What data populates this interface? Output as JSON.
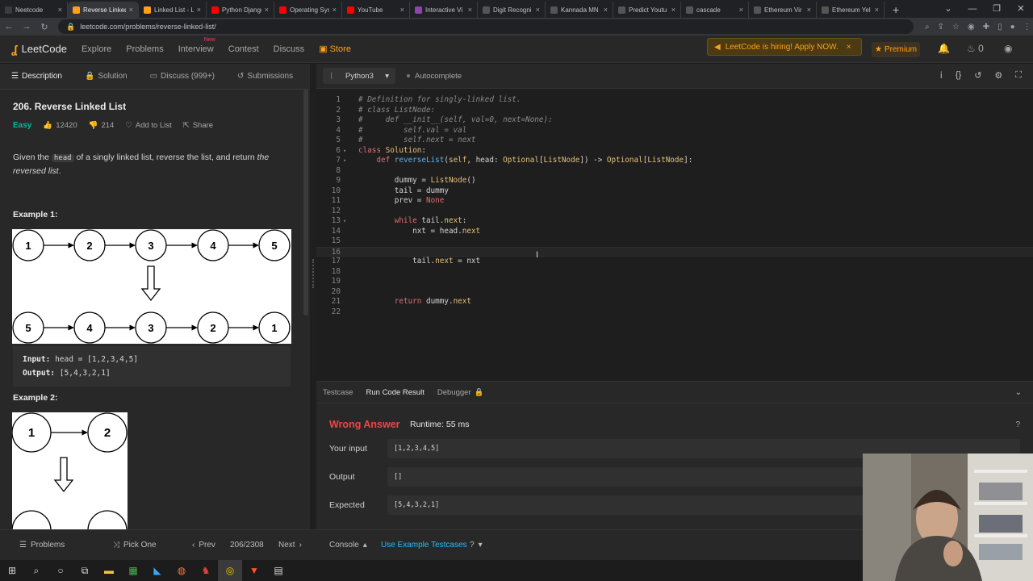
{
  "browser": {
    "tabs": [
      {
        "title": "Neetcode",
        "color": "#3c3c3c"
      },
      {
        "title": "Reverse Linked",
        "color": "#ffa116",
        "active": true
      },
      {
        "title": "Linked List - L",
        "color": "#ffa116"
      },
      {
        "title": "Python Django",
        "color": "#ff0000"
      },
      {
        "title": "Operating Sys",
        "color": "#ff0000"
      },
      {
        "title": "YouTube",
        "color": "#ff0000"
      },
      {
        "title": "Interactive Vi",
        "color": "#8e44ad"
      },
      {
        "title": "Digit Recogni",
        "color": "#555555"
      },
      {
        "title": "Kannada MN",
        "color": "#555555"
      },
      {
        "title": "Predict Youtu",
        "color": "#555555"
      },
      {
        "title": "cascade",
        "color": "#555555"
      },
      {
        "title": "Ethereum Vir",
        "color": "#555555"
      },
      {
        "title": "Ethereum Yel",
        "color": "#555555"
      }
    ],
    "new_tab": "+",
    "url": "leetcode.com/problems/reverse-linked-list/"
  },
  "nav": {
    "logo": "LeetCode",
    "links": [
      "Explore",
      "Problems",
      "Interview",
      "Contest",
      "Discuss"
    ],
    "new_tag": "New",
    "store": "Store",
    "hiring": "LeetCode is hiring! Apply NOW.",
    "premium": "Premium",
    "streak": "0"
  },
  "desc_tabs": {
    "description": "Description",
    "solution": "Solution",
    "discuss": "Discuss (999+)",
    "submissions": "Submissions"
  },
  "problem": {
    "title": "206. Reverse Linked List",
    "difficulty": "Easy",
    "likes": "12420",
    "dislikes": "214",
    "add_to_list": "Add to List",
    "share": "Share",
    "desc_1": "Given the ",
    "desc_code": "head",
    "desc_2": " of a singly linked list, reverse the list, and return ",
    "desc_em": "the reversed list",
    "desc_3": "."
  },
  "example1": {
    "heading": "Example 1:",
    "top_nodes": [
      "1",
      "2",
      "3",
      "4",
      "5"
    ],
    "bottom_nodes": [
      "5",
      "4",
      "3",
      "2",
      "1"
    ],
    "input_label": "Input:",
    "input_value": "head = [1,2,3,4,5]",
    "output_label": "Output:",
    "output_value": "[5,4,3,2,1]"
  },
  "example2": {
    "heading": "Example 2:",
    "top_nodes": [
      "1",
      "2"
    ]
  },
  "editor": {
    "language": "Python3",
    "autocomplete": "Autocomplete",
    "lines": [
      "1",
      "2",
      "3",
      "4",
      "5",
      "6",
      "7",
      "8",
      "9",
      "10",
      "11",
      "12",
      "13",
      "14",
      "15",
      "16",
      "17",
      "18",
      "19",
      "20",
      "21",
      "22"
    ]
  },
  "console": {
    "tabs": [
      "Testcase",
      "Run Code Result",
      "Debugger"
    ],
    "verdict": "Wrong Answer",
    "runtime": "Runtime: 55 ms",
    "your_input_label": "Your input",
    "your_input": "[1,2,3,4,5]",
    "output_label": "Output",
    "output": "[]",
    "expected_label": "Expected",
    "expected": "[5,4,3,2,1]"
  },
  "bottom": {
    "problems": "Problems",
    "pick_one": "Pick One",
    "prev": "Prev",
    "page": "206/2308",
    "next": "Next",
    "console": "Console",
    "use_example": "Use Example Testcases"
  }
}
